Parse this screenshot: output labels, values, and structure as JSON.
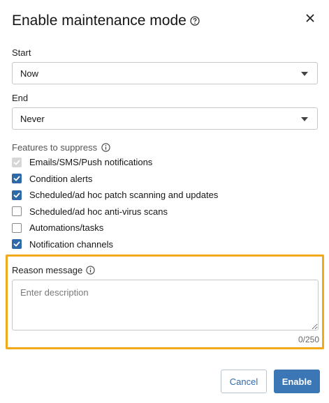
{
  "dialog": {
    "title": "Enable maintenance mode",
    "help_icon": "question-circle-icon",
    "close_icon": "close-icon"
  },
  "start": {
    "label": "Start",
    "value": "Now"
  },
  "end": {
    "label": "End",
    "value": "Never"
  },
  "features": {
    "label": "Features to suppress",
    "info_icon": "info-icon",
    "items": [
      {
        "label": "Emails/SMS/Push notifications",
        "state": "checked-disabled"
      },
      {
        "label": "Condition alerts",
        "state": "checked"
      },
      {
        "label": "Scheduled/ad hoc patch scanning and updates",
        "state": "checked"
      },
      {
        "label": "Scheduled/ad hoc anti-virus scans",
        "state": "unchecked"
      },
      {
        "label": "Automations/tasks",
        "state": "unchecked"
      },
      {
        "label": "Notification channels",
        "state": "checked"
      }
    ]
  },
  "reason": {
    "label": "Reason message",
    "info_icon": "info-icon",
    "value": "",
    "placeholder": "Enter description",
    "counter": "0/250"
  },
  "actions": {
    "cancel_label": "Cancel",
    "enable_label": "Enable"
  },
  "colors": {
    "accent": "#3b76b5",
    "checkbox_checked": "#2f6aa8",
    "highlight_border": "#f2a91c"
  }
}
